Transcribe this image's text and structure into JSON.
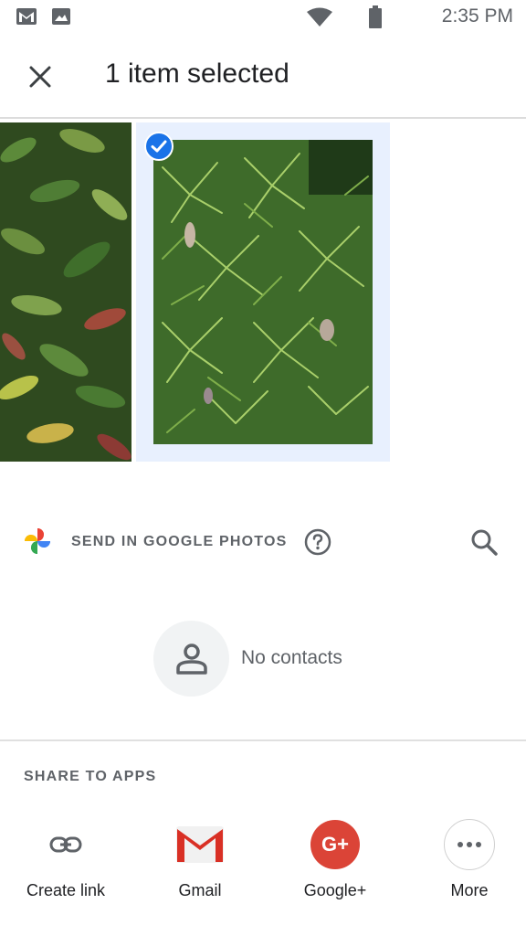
{
  "status_bar": {
    "time": "2:35 PM",
    "icons": [
      "gmail-notification-icon",
      "image-notification-icon",
      "wifi-icon",
      "battery-icon"
    ]
  },
  "header": {
    "title": "1 item selected",
    "close_icon": "close-icon"
  },
  "photos": {
    "items": [
      {
        "name": "photo-1",
        "selected": false
      },
      {
        "name": "photo-2",
        "selected": true
      }
    ],
    "selection_color": "#e8f0fe",
    "check_color": "#1a73e8"
  },
  "send_section": {
    "label": "SEND IN GOOGLE PHOTOS",
    "help_icon": "help-icon",
    "search_icon": "search-icon"
  },
  "contacts": {
    "empty_text": "No contacts"
  },
  "share_section": {
    "label": "SHARE TO APPS",
    "apps": [
      {
        "label": "Create link",
        "icon": "link-icon"
      },
      {
        "label": "Gmail",
        "icon": "gmail-icon"
      },
      {
        "label": "Google+",
        "icon": "google-plus-icon",
        "glyph": "G+"
      },
      {
        "label": "More",
        "icon": "more-icon"
      }
    ]
  }
}
